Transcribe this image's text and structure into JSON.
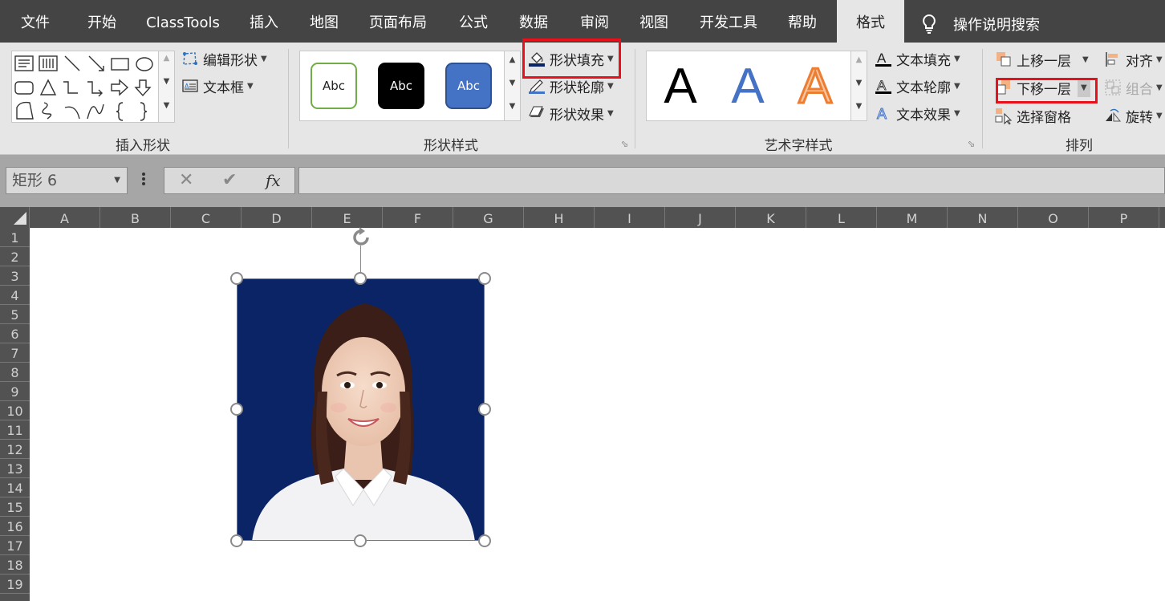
{
  "tabs": [
    {
      "label": "文件",
      "active": false
    },
    {
      "label": "开始",
      "active": false
    },
    {
      "label": "ClassTools",
      "active": false
    },
    {
      "label": "插入",
      "active": false
    },
    {
      "label": "地图",
      "active": false
    },
    {
      "label": "页面布局",
      "active": false
    },
    {
      "label": "公式",
      "active": false
    },
    {
      "label": "数据",
      "active": false
    },
    {
      "label": "审阅",
      "active": false
    },
    {
      "label": "视图",
      "active": false
    },
    {
      "label": "开发工具",
      "active": false
    },
    {
      "label": "帮助",
      "active": false
    },
    {
      "label": "格式",
      "active": true
    }
  ],
  "tell_me": {
    "icon": "lightbulb-icon",
    "label": "操作说明搜索"
  },
  "groups": {
    "insert_shapes": {
      "label": "插入形状",
      "edit_shape": "编辑形状",
      "text_box": "文本框"
    },
    "shape_styles": {
      "label": "形状样式",
      "samples": [
        {
          "text": "Abc",
          "style": "outline-green"
        },
        {
          "text": "Abc",
          "style": "black-fill"
        },
        {
          "text": "Abc",
          "style": "blue-fill"
        }
      ],
      "shape_fill": "形状填充",
      "shape_outline": "形状轮廓",
      "shape_effects": "形状效果"
    },
    "wordart_styles": {
      "label": "艺术字样式",
      "samples": [
        "A",
        "A",
        "A"
      ],
      "text_fill": "文本填充",
      "text_outline": "文本轮廓",
      "text_effects": "文本效果"
    },
    "arrange": {
      "label": "排列",
      "bring_forward": "上移一层",
      "send_backward": "下移一层",
      "selection_pane": "选择窗格",
      "align": "对齐",
      "group": "组合",
      "rotate": "旋转"
    }
  },
  "formula_bar": {
    "name_box": "矩形 6",
    "cancel_symbol": "✕",
    "enter_symbol": "✔",
    "fx_symbol": "fx",
    "formula": ""
  },
  "columns": [
    "A",
    "B",
    "C",
    "D",
    "E",
    "F",
    "G",
    "H",
    "I",
    "J",
    "K",
    "L",
    "M",
    "N",
    "O",
    "P"
  ],
  "rows": [
    "1",
    "2",
    "3",
    "4",
    "5",
    "6",
    "7",
    "8",
    "9",
    "10",
    "11",
    "12",
    "13",
    "14",
    "15",
    "16",
    "17",
    "18",
    "19"
  ],
  "colors": {
    "tab_bar": "#444444",
    "ribbon": "#e6e6e6",
    "highlight_box": "#e8101a",
    "photo_background": "#0a2466"
  }
}
